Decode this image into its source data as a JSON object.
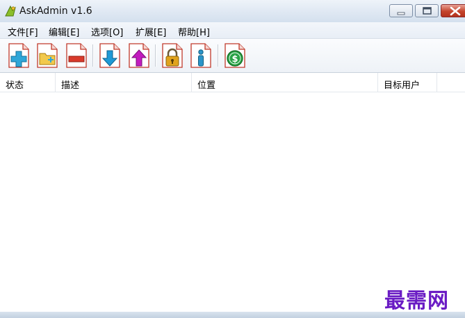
{
  "window": {
    "title": "AskAdmin v1.6"
  },
  "menu": [
    {
      "label": "文件[F]"
    },
    {
      "label": "编辑[E]"
    },
    {
      "label": "选项[O]"
    },
    {
      "label": "扩展[E]"
    },
    {
      "label": "帮助[H]"
    }
  ],
  "toolbar": {
    "buttons": [
      {
        "icon": "add-icon"
      },
      {
        "icon": "add-folder-icon"
      },
      {
        "icon": "remove-icon"
      },
      {
        "icon": "move-down-icon"
      },
      {
        "icon": "move-up-icon"
      },
      {
        "icon": "lock-icon"
      },
      {
        "icon": "info-icon"
      },
      {
        "icon": "donate-icon"
      }
    ]
  },
  "list": {
    "columns": [
      {
        "label": "状态"
      },
      {
        "label": "描述"
      },
      {
        "label": "位置"
      },
      {
        "label": "目标用户"
      }
    ],
    "rows": []
  },
  "watermark": "最需网",
  "colors": {
    "add": "#2ea6d8",
    "remove": "#d93a2b",
    "down": "#1e9ad6",
    "up": "#c21bbf",
    "lock": "#e0a31d",
    "info": "#2b94c9",
    "donate": "#27a245",
    "watermark": "#6a1bc4"
  }
}
